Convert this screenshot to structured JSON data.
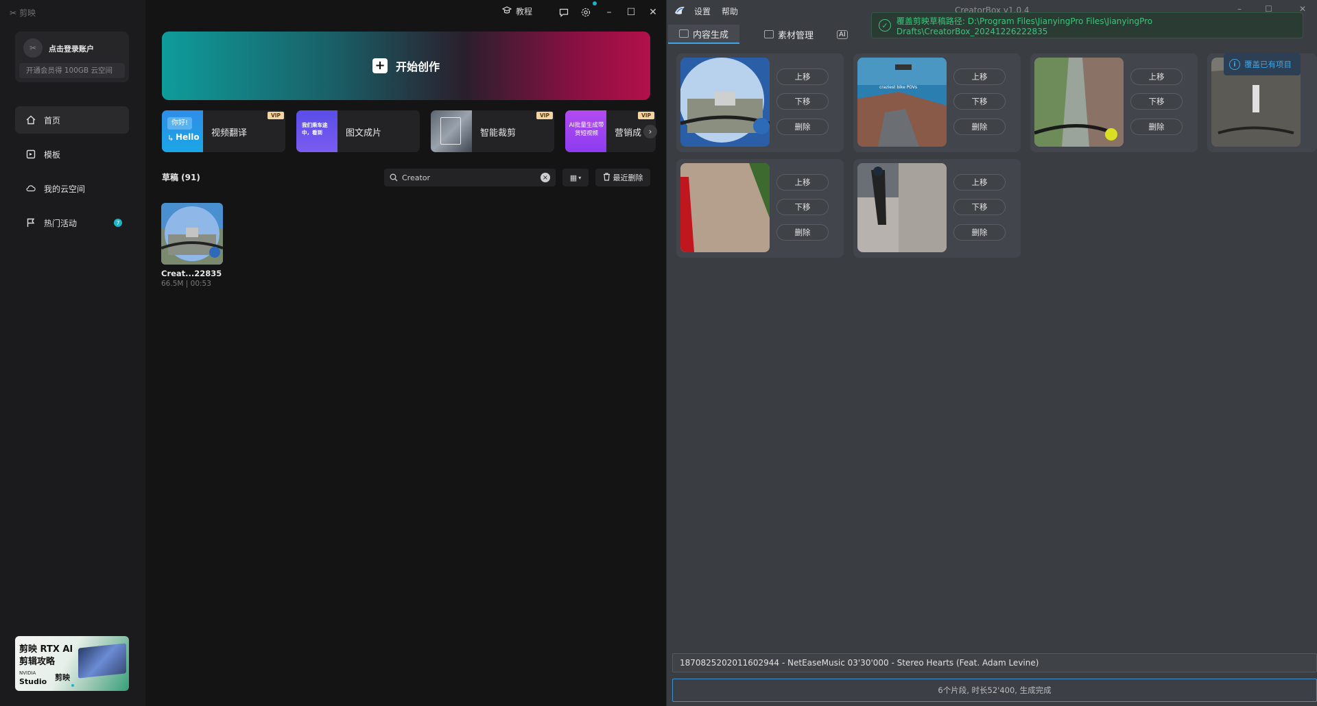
{
  "jianying": {
    "brand": "剪映",
    "login": {
      "title": "点击登录账户",
      "vip": "开通会员得 100GB 云空间"
    },
    "nav": [
      {
        "label": "首页",
        "icon": "home-icon"
      },
      {
        "label": "模板",
        "icon": "template-icon"
      },
      {
        "label": "我的云空间",
        "icon": "cloud-icon"
      },
      {
        "label": "热门活动",
        "icon": "flag-icon",
        "badge": "7"
      }
    ],
    "promo": {
      "line1": "剪映 RTX AI",
      "line2": "剪辑攻略",
      "line3": "NVIDIA",
      "line4": "Studio",
      "line5": "剪映"
    },
    "topbar": {
      "tutorial": "教程"
    },
    "start_label": "开始创作",
    "tools": [
      {
        "label": "视频翻译",
        "thumb_top": "你好!",
        "thumb_bottom": "Hello",
        "vip": "VIP"
      },
      {
        "label": "图文成片",
        "thumb_text": "我们乘车途中，看到",
        "vip": ""
      },
      {
        "label": "智能裁剪",
        "vip": "VIP"
      },
      {
        "label": "营销成",
        "thumb_text": "AI批量生成带货短视频",
        "vip": "VIP"
      }
    ],
    "drafts": {
      "title": "草稿 (91)",
      "search_value": "Creator",
      "recent_delete": "最近删除",
      "items": [
        {
          "name": "Creat...22835",
          "meta": "66.5M | 00:53"
        }
      ]
    }
  },
  "creatorbox": {
    "menu": [
      "设置",
      "帮助"
    ],
    "title": "CreatorBox v1.0.4",
    "tabs": [
      "内容生成",
      "素材管理",
      "AI"
    ],
    "toast": "覆盖剪映草稿路径: D:\\Program Files\\JianyingPro Files\\JianyingPro Drafts\\CreatorBox_20241226222835",
    "overwrite_label": "覆盖已有项目",
    "clip_buttons": {
      "up": "上移",
      "down": "下移",
      "delete": "删除"
    },
    "clip_thumb_caption": "craziest bike POVs",
    "music": "1870825202011602944 - NetEaseMusic 03'30'000 - Stereo Hearts (Feat. Adam Levine)",
    "status": "6个片段, 时长52'400, 生成完成"
  }
}
